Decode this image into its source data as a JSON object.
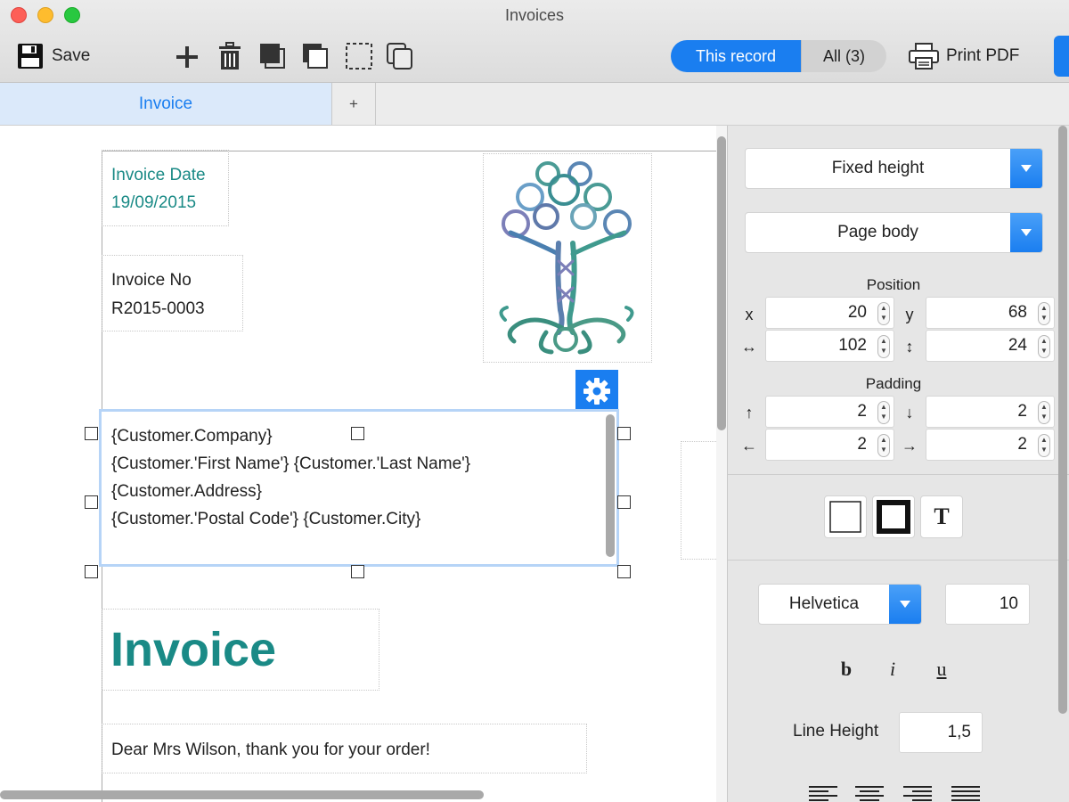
{
  "window": {
    "title": "Invoices"
  },
  "toolbar": {
    "save_label": "Save",
    "segment": {
      "this_record": "This record",
      "all": "All (3)"
    },
    "print_label": "Print PDF"
  },
  "tabs": {
    "invoice": "Invoice",
    "add": "+"
  },
  "document": {
    "invoice_date_label": "Invoice Date",
    "invoice_date_value": "19/09/2015",
    "invoice_no_label": "Invoice No",
    "invoice_no_value": "R2015-0003",
    "address_lines": [
      "{Customer.Company}",
      "{Customer.'First Name'} {Customer.'Last Name'}",
      "{Customer.Address}",
      "{Customer.'Postal Code'} {Customer.City}"
    ],
    "heading": "Invoice",
    "greeting": "Dear Mrs Wilson, thank you for your order!"
  },
  "inspector": {
    "height_mode": "Fixed height",
    "section": "Page body",
    "position_label": "Position",
    "position": {
      "x_label": "x",
      "x": "20",
      "y_label": "y",
      "y": "68",
      "w_label": "↔",
      "w": "102",
      "h_label": "↕",
      "h": "24"
    },
    "padding_label": "Padding",
    "padding": {
      "top_label": "↑",
      "top": "2",
      "bottom_label": "↓",
      "bottom": "2",
      "left_label": "←",
      "left": "2",
      "right_label": "→",
      "right": "2"
    },
    "text_style_label": "T",
    "font": "Helvetica",
    "font_size": "10",
    "bold": "b",
    "italic": "i",
    "underline": "u",
    "line_height_label": "Line Height",
    "line_height": "1,5"
  },
  "colors": {
    "accent": "#1a7ef0",
    "teal": "#1a8a86"
  }
}
